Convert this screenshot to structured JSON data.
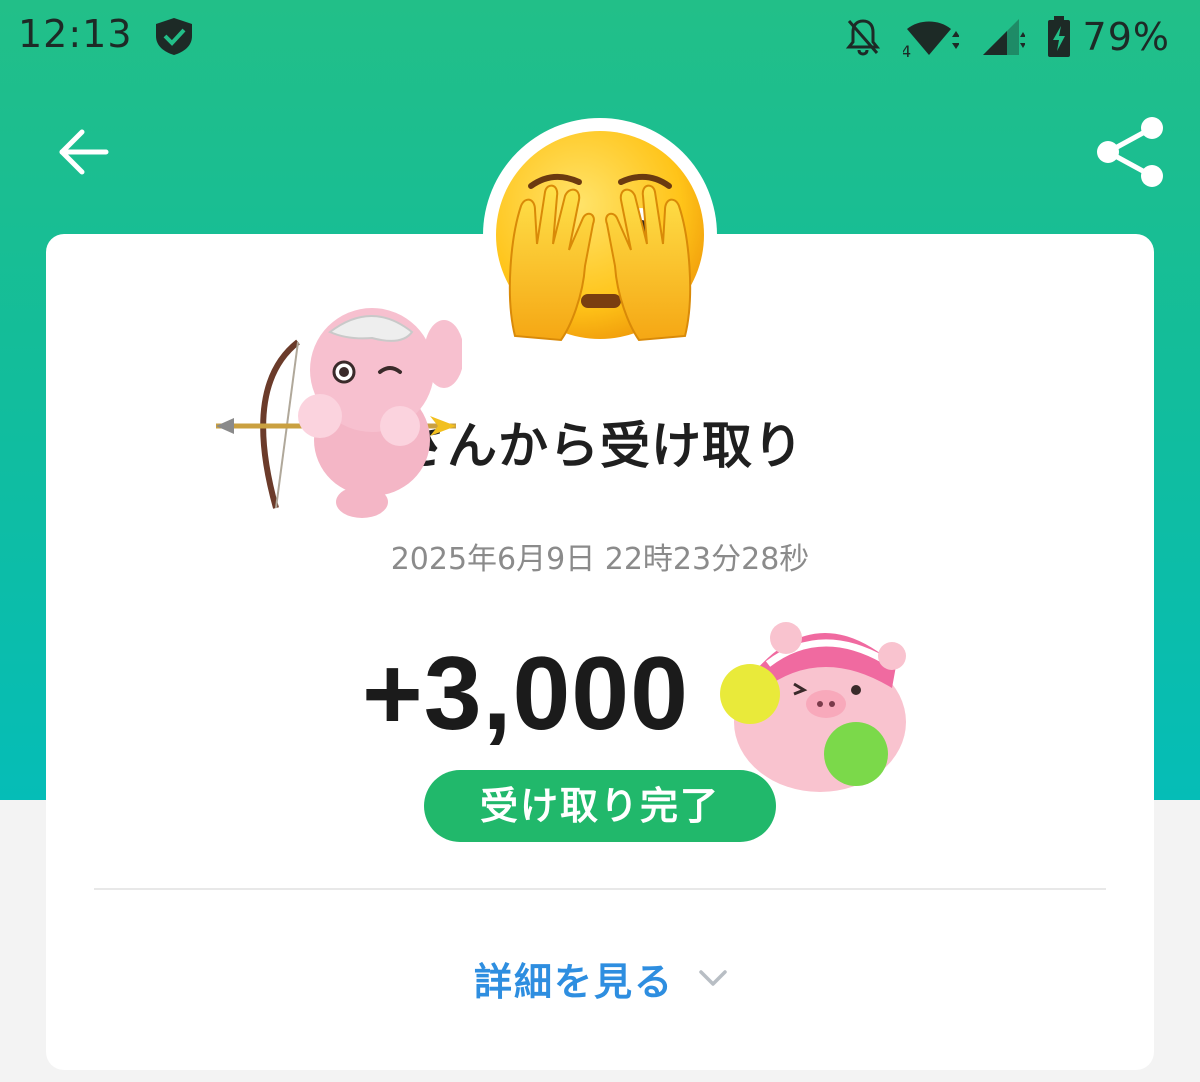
{
  "status_bar": {
    "time": "12:13",
    "battery_percent": "79%",
    "network_badge": "4",
    "icons": [
      "shield-check-icon",
      "bell-off-icon",
      "wifi-icon",
      "signal-icon",
      "battery-charging-icon"
    ]
  },
  "header": {
    "back_icon": "arrow-left-icon",
    "share_icon": "share-icon"
  },
  "transaction": {
    "avatar": "face-with-hands-over-eyes-emoji",
    "title": "さんから受け取り",
    "datetime": "2025年6月9日 22時23分28秒",
    "amount": "+3,000",
    "status": "受け取り完了"
  },
  "details": {
    "label": "詳細を見る",
    "icon": "chevron-down-icon"
  },
  "stickers": [
    "pink-bunny-archer-sticker",
    "pink-pig-cheerleader-sticker"
  ],
  "colors": {
    "header_gradient_top": "#22bf88",
    "header_gradient_bottom": "#05bdb7",
    "status_pill": "#21b86b",
    "link": "#2e8ee0",
    "amount_text": "#1b1b1b",
    "timestamp_text": "#8b8b8b"
  }
}
